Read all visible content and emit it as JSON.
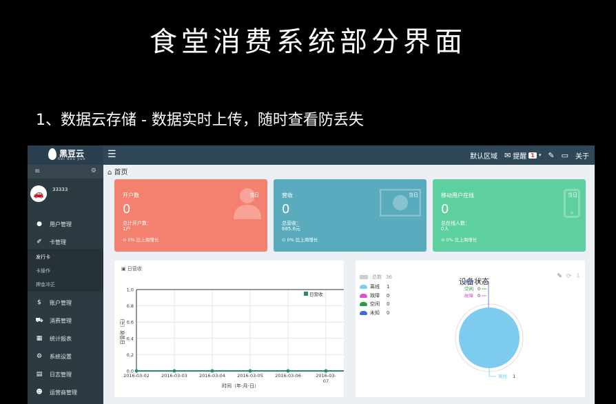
{
  "banner": {
    "title": "食堂消费系统部分界面",
    "subtitle": "1、数据云存储 - 数据实时上传，随时查看防丢失"
  },
  "app": {
    "logo_text": "黑豆云",
    "logo_sub": "hei dou yun",
    "topbar": {
      "region": "默认区域",
      "alerts_label": "提醒",
      "alerts_count": "1",
      "about": "关于"
    },
    "sidebar": {
      "user_name": "33333",
      "menu": [
        {
          "label": "用户管理",
          "icon": "user-icon"
        },
        {
          "label": "卡管理",
          "icon": "tag-icon"
        }
      ],
      "submenu": [
        "发行卡",
        "卡操作",
        "押金冲正"
      ],
      "menu2": [
        {
          "label": "账户管理",
          "icon": "dollar-icon"
        },
        {
          "label": "消费管理",
          "icon": "cart-icon"
        },
        {
          "label": "统计报表",
          "icon": "table-icon"
        },
        {
          "label": "系统设置",
          "icon": "gear-icon"
        },
        {
          "label": "日志管理",
          "icon": "log-icon"
        },
        {
          "label": "运营商管理",
          "icon": "group-icon"
        }
      ]
    },
    "breadcrumb": "首页",
    "cards": [
      {
        "title": "开户数",
        "value": "0",
        "tag": "当日",
        "line1": "总计开户数：",
        "line2": "1户",
        "footer": "0% 比上周增长",
        "color": "#f4806f"
      },
      {
        "title": "营收",
        "value": "0",
        "tag": "当日",
        "line1": "总营收：",
        "line2": "685.6元",
        "footer": "0% 比上周增长",
        "color": "#5aabbd"
      },
      {
        "title": "移动用户在线",
        "value": "0",
        "tag": "当日",
        "line1": "总在线人数：",
        "line2": "0人",
        "footer": "0% 比上周增长",
        "color": "#5ecf9f"
      }
    ],
    "chart_panel_title": "日营收",
    "device_panel": {
      "title": "设备状态",
      "total_label": "总数",
      "total_value": "36",
      "legend": [
        {
          "label": "离线",
          "value": "1",
          "color": "#7ecbf0"
        },
        {
          "label": "故障",
          "value": "0",
          "color": "#d94fd0"
        },
        {
          "label": "空闲",
          "value": "0",
          "color": "#2a9d3a"
        },
        {
          "label": "未知",
          "value": "0",
          "color": "#3d6ad6"
        }
      ],
      "pie_labels": [
        {
          "label": "未知",
          "value": "0"
        },
        {
          "label": "空闲",
          "value": "0"
        },
        {
          "label": "故障",
          "value": "0"
        },
        {
          "label": "离线",
          "value": "1"
        }
      ]
    }
  },
  "chart_data": {
    "type": "line",
    "title": "",
    "legend_label": "日营收",
    "xlabel": "时间（年-月-日）",
    "ylabel": "日营收（元）",
    "x": [
      "2016-03-02",
      "2016-03-03",
      "2016-03-04",
      "2016-03-05",
      "2016-03-06",
      "2016-03-07",
      "2016-03-08"
    ],
    "x_display": [
      "2016-03-02",
      "2016-03-03",
      "2016-03-04",
      "2016-03-05",
      "2016-03-06",
      "2016-03-",
      "2016-03-"
    ],
    "x_display2": [
      "",
      "",
      "",
      "",
      "",
      "07",
      "03"
    ],
    "series": [
      {
        "name": "日营收",
        "values": [
          0,
          0,
          0,
          0,
          0,
          0,
          0
        ]
      }
    ],
    "ylim": [
      0,
      1.0
    ],
    "yticks": [
      "0.0",
      "0.2",
      "0.4",
      "0.6",
      "0.8",
      "1.0"
    ],
    "grid": true,
    "line_color": "#2a8a6a"
  }
}
